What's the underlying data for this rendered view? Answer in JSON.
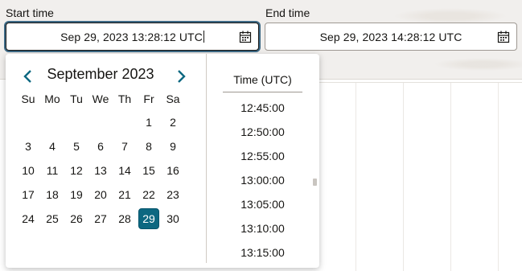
{
  "start": {
    "label": "Start time",
    "value": "Sep 29, 2023 13:28:12 UTC"
  },
  "end": {
    "label": "End time",
    "value": "Sep 29, 2023 14:28:12 UTC"
  },
  "calendar": {
    "month_title": "September 2023",
    "weekdays": [
      "Su",
      "Mo",
      "Tu",
      "We",
      "Th",
      "Fr",
      "Sa"
    ],
    "days": [
      "1",
      "2",
      "3",
      "4",
      "5",
      "6",
      "7",
      "8",
      "9",
      "10",
      "11",
      "12",
      "13",
      "14",
      "15",
      "16",
      "17",
      "18",
      "19",
      "20",
      "21",
      "22",
      "23",
      "24",
      "25",
      "26",
      "27",
      "28",
      "29",
      "30"
    ],
    "selected_day": "29"
  },
  "time_list": {
    "header": "Time (UTC)",
    "items": [
      "12:45:00",
      "12:50:00",
      "12:55:00",
      "13:00:00",
      "13:05:00",
      "13:10:00",
      "13:15:00"
    ]
  },
  "colors": {
    "accent": "#0d6881",
    "focus_ring": "#3e6a86"
  }
}
